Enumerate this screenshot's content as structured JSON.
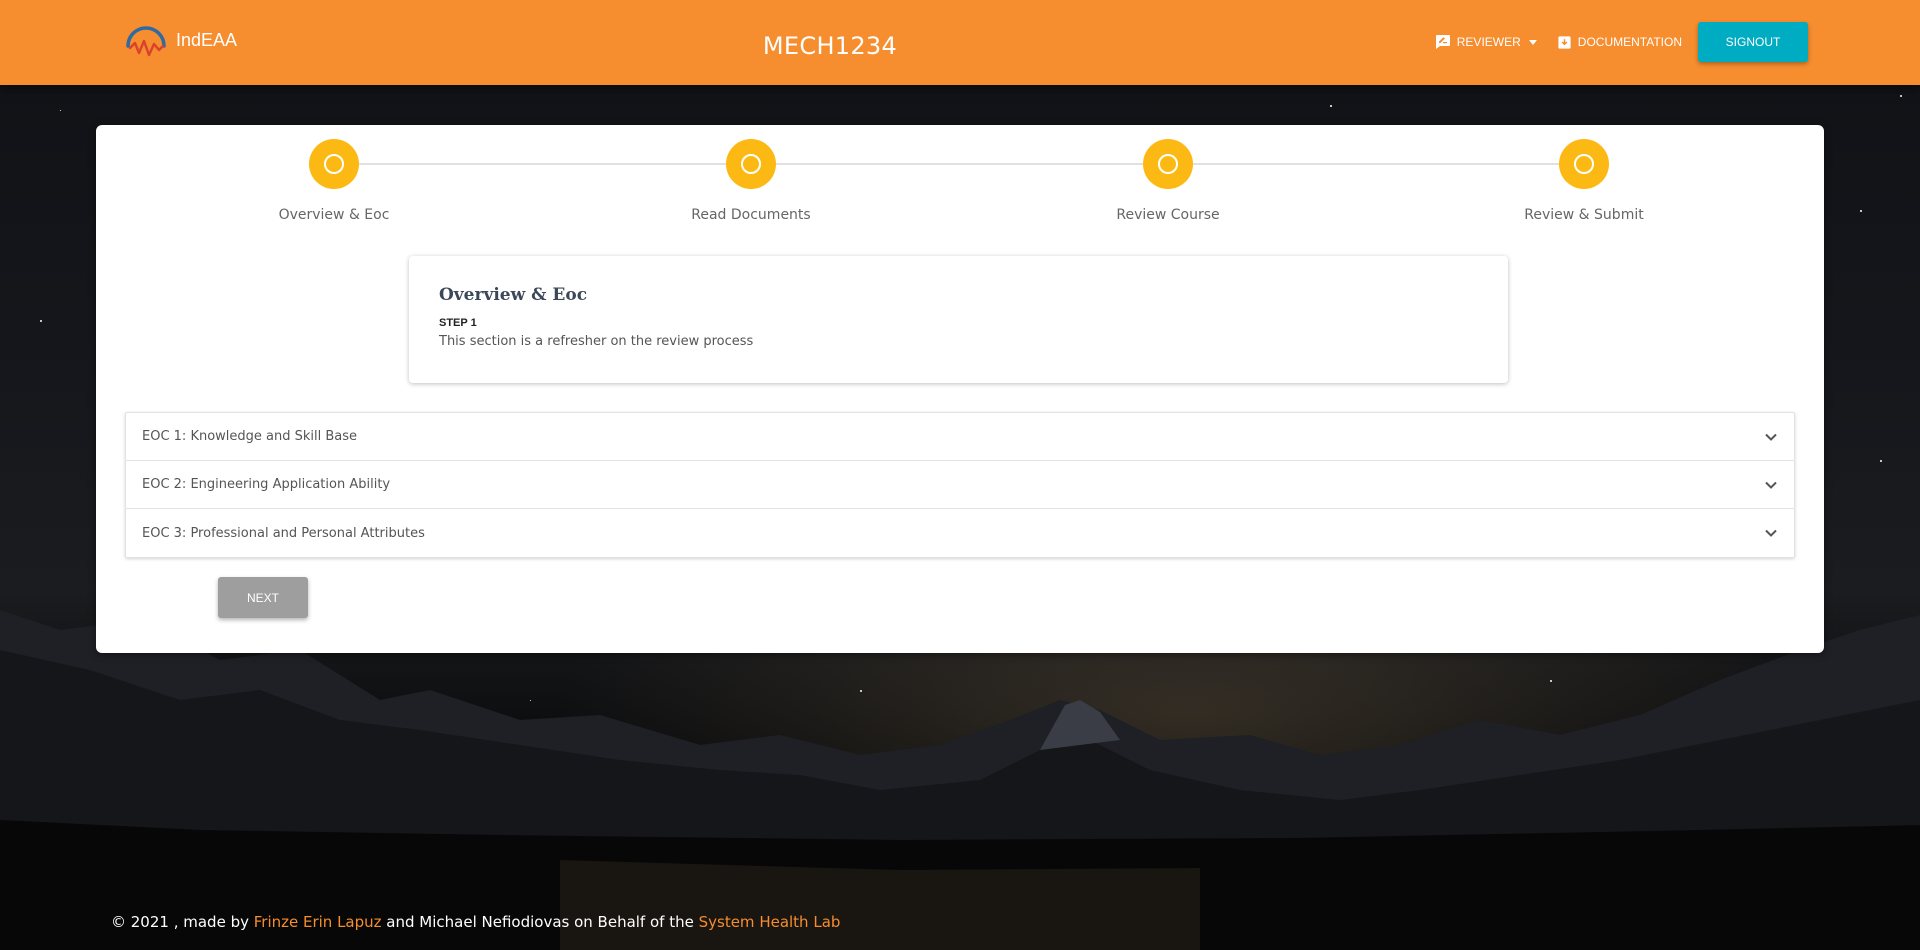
{
  "header": {
    "brand": "IndEAA",
    "course_code": "MECH1234",
    "nav": {
      "reviewer_label": "Reviewer",
      "documentation_label": "Documentation",
      "signout_label": "Signout"
    }
  },
  "stepper": {
    "steps": [
      {
        "label": "Overview & Eoc"
      },
      {
        "label": "Read Documents"
      },
      {
        "label": "Review Course"
      },
      {
        "label": "Review & Submit"
      }
    ]
  },
  "info": {
    "title": "Overview & Eoc",
    "step": "STEP 1",
    "description": "This section is a refresher on the review process"
  },
  "accordion": {
    "items": [
      {
        "label": "EOC 1: Knowledge and Skill Base"
      },
      {
        "label": "EOC 2: Engineering Application Ability"
      },
      {
        "label": "EOC 3: Professional and Personal Attributes"
      }
    ]
  },
  "actions": {
    "next_label": "Next"
  },
  "footer": {
    "prefix": "© 2021 , made by ",
    "author_link": "Frinze Erin Lapuz",
    "middle": " and Michael Nefiodiovas on Behalf of the ",
    "lab_link": "System Health Lab"
  },
  "colors": {
    "header": "#f68d2e",
    "signout": "#00acc1",
    "step": "#fdb913",
    "link": "#f68d2e",
    "next_disabled": "#9e9e9e"
  },
  "icons": {
    "reviewer": "rate-review-icon",
    "documentation": "archive-icon",
    "accordion": "chevron-down-icon"
  }
}
